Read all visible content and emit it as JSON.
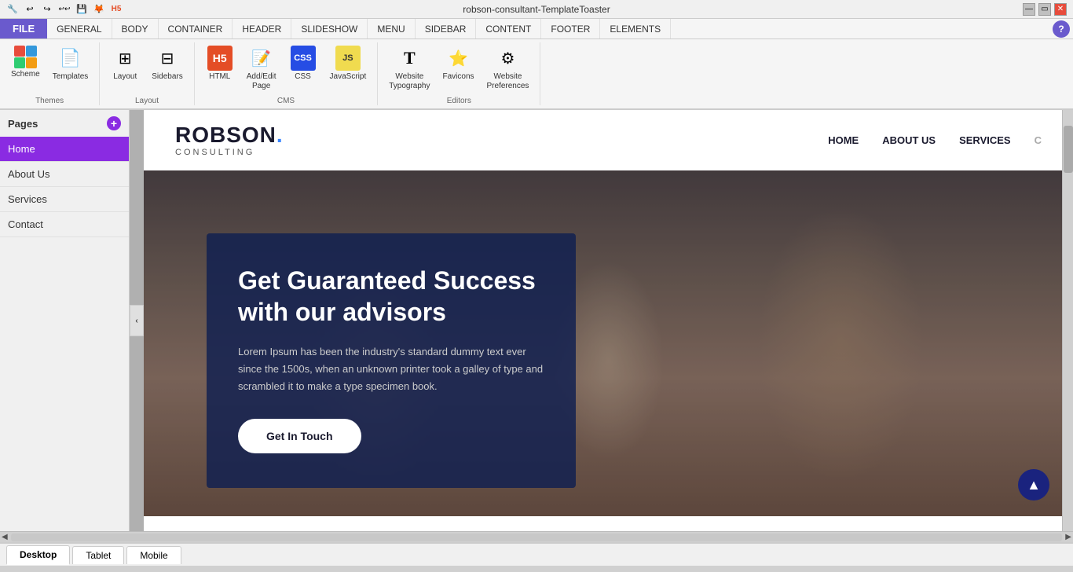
{
  "titlebar": {
    "title": "robson-consultant-TemplateToaster",
    "controls": [
      "minimize",
      "maximize",
      "close"
    ]
  },
  "toolbar_icons": [
    "↩",
    "↪",
    "↩↩",
    "💾",
    "🦊",
    "H5"
  ],
  "ribbon_menu": {
    "file": "FILE",
    "items": [
      "GENERAL",
      "BODY",
      "CONTAINER",
      "HEADER",
      "SLIDESHOW",
      "MENU",
      "SIDEBAR",
      "CONTENT",
      "FOOTER",
      "ELEMENTS"
    ],
    "help": "?"
  },
  "ribbon_groups": {
    "themes": {
      "label": "Themes",
      "buttons": [
        {
          "id": "scheme",
          "label": "Scheme"
        },
        {
          "id": "templates",
          "label": "Templates"
        }
      ]
    },
    "layout": {
      "label": "Layout",
      "buttons": [
        {
          "id": "layout",
          "label": "Layout"
        },
        {
          "id": "sidebars",
          "label": "Sidebars"
        }
      ]
    },
    "cms": {
      "label": "CMS",
      "buttons": [
        {
          "id": "html",
          "label": "HTML"
        },
        {
          "id": "addpage",
          "label": "Add/Edit\nPage"
        },
        {
          "id": "css",
          "label": "CSS"
        },
        {
          "id": "javascript",
          "label": "JavaScript"
        }
      ]
    },
    "editors": {
      "label": "Editors",
      "buttons": [
        {
          "id": "website-typography",
          "label": "Website\nTypography"
        },
        {
          "id": "favicons",
          "label": "Favicons"
        },
        {
          "id": "website-preferences",
          "label": "Website\nPreferences"
        }
      ]
    }
  },
  "sidebar": {
    "header": "Pages",
    "add_btn": "+",
    "pages": [
      {
        "id": "home",
        "label": "Home",
        "active": true
      },
      {
        "id": "about-us",
        "label": "About Us"
      },
      {
        "id": "services",
        "label": "Services"
      },
      {
        "id": "contact",
        "label": "Contact"
      }
    ]
  },
  "preview": {
    "logo": {
      "name": "ROBSON.",
      "sub": "CONSULTING"
    },
    "nav_links": [
      "HOME",
      "ABOUT US",
      "SERVICES",
      "C"
    ],
    "hero": {
      "title": "Get Guaranteed Success with our advisors",
      "description": "Lorem Ipsum has been the industry's standard dummy text ever since the 1500s, when an unknown printer took a galley of type and scrambled it to make a type specimen book.",
      "cta": "Get In Touch"
    }
  },
  "bottom_tabs": [
    "Desktop",
    "Tablet",
    "Mobile"
  ],
  "canvas_toggle": "‹"
}
